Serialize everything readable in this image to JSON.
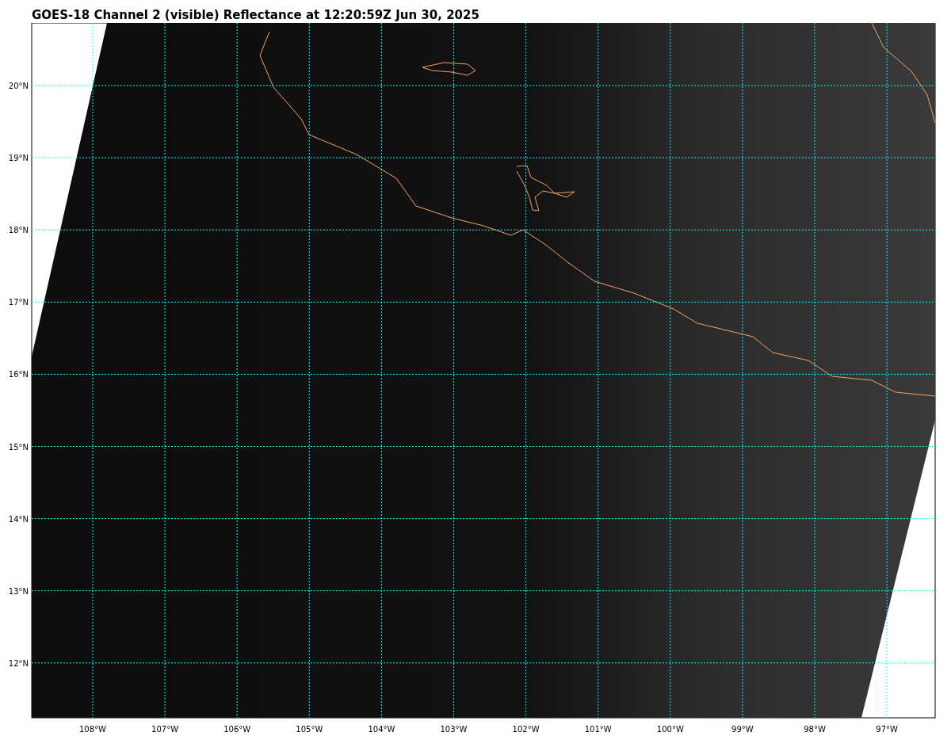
{
  "title": "GOES-18 Channel 2 (visible) Reflectance at 12:20:59Z Jun 30, 2025",
  "map": {
    "lat_labels": [
      "20°N",
      "19°N",
      "18°N",
      "17°N",
      "16°N",
      "15°N",
      "14°N",
      "13°N",
      "12°N"
    ],
    "lon_labels": [
      "108°W",
      "107°W",
      "106°W",
      "105°W",
      "104°W",
      "103°W",
      "102°W",
      "101°W",
      "100°W",
      "99°W",
      "98°W",
      "97°W"
    ]
  }
}
